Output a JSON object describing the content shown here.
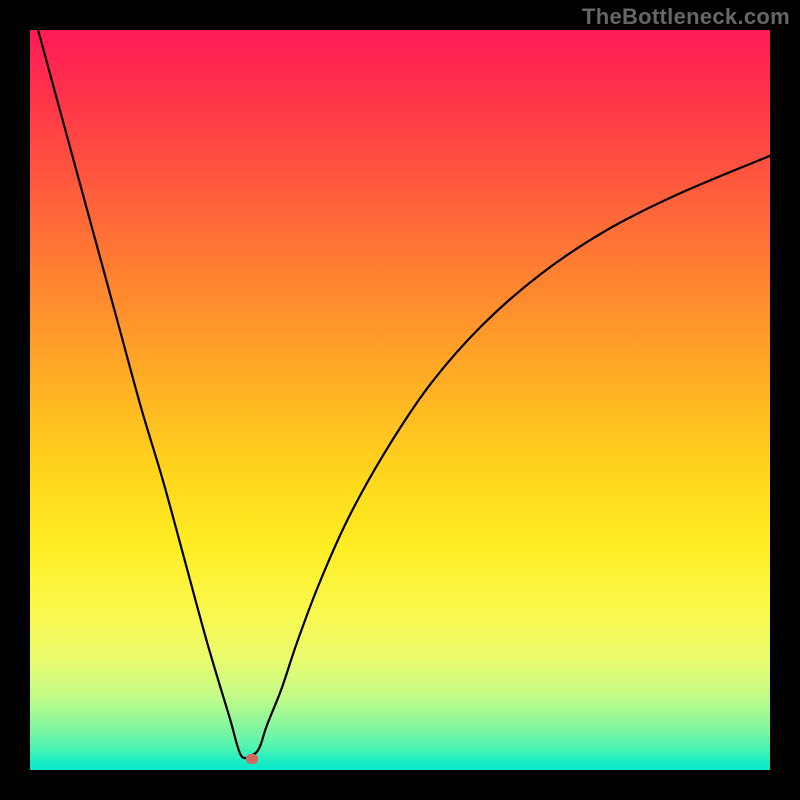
{
  "attribution": "TheBottleneck.com",
  "chart_data": {
    "type": "line",
    "title": "",
    "xlabel": "",
    "ylabel": "",
    "xlim": [
      0,
      100
    ],
    "ylim": [
      0,
      100
    ],
    "grid": false,
    "legend": false,
    "series": [
      {
        "name": "bottleneck-curve",
        "x": [
          0,
          3,
          6,
          9,
          12,
          15,
          18,
          21,
          24,
          27,
          28.5,
          30,
          31,
          32,
          34,
          36,
          39,
          43,
          48,
          54,
          61,
          69,
          78,
          88,
          100
        ],
        "y": [
          104,
          93,
          82,
          71,
          60,
          49,
          39,
          28,
          17,
          7,
          2,
          2,
          3,
          6,
          11,
          17,
          25,
          34,
          43,
          52,
          60,
          67,
          73,
          78,
          83
        ]
      }
    ],
    "marker": {
      "x": 30,
      "y": 1.5
    },
    "gradient_stops": [
      {
        "pct": 0,
        "color": "#ff1a56"
      },
      {
        "pct": 50,
        "color": "#ffc61f"
      },
      {
        "pct": 80,
        "color": "#fbf84a"
      },
      {
        "pct": 100,
        "color": "#07e8ce"
      }
    ]
  }
}
